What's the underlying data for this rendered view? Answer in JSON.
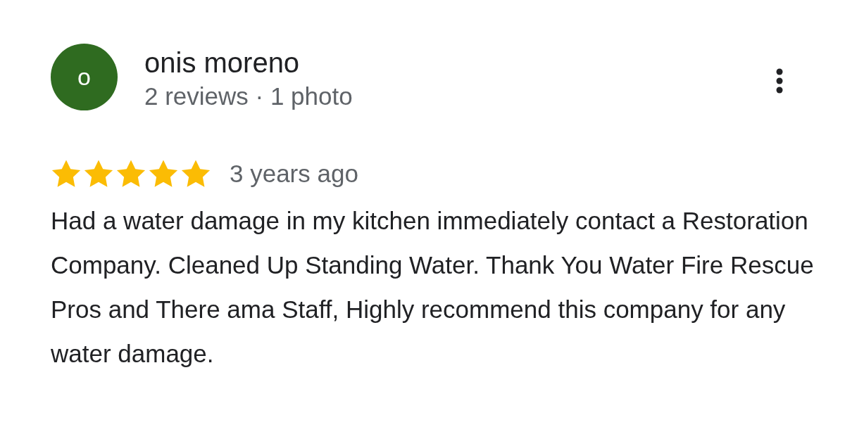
{
  "review": {
    "avatar_letter": "o",
    "author": "onis moreno",
    "meta": "2 reviews · 1 photo",
    "stars": 5,
    "time": "3 years ago",
    "text": "Had a water damage in my kitchen immediately contact a Restoration Company. Cleaned Up Standing Water. Thank You Water Fire Rescue Pros and There ama Staff, Highly recommend this company for any water damage."
  }
}
